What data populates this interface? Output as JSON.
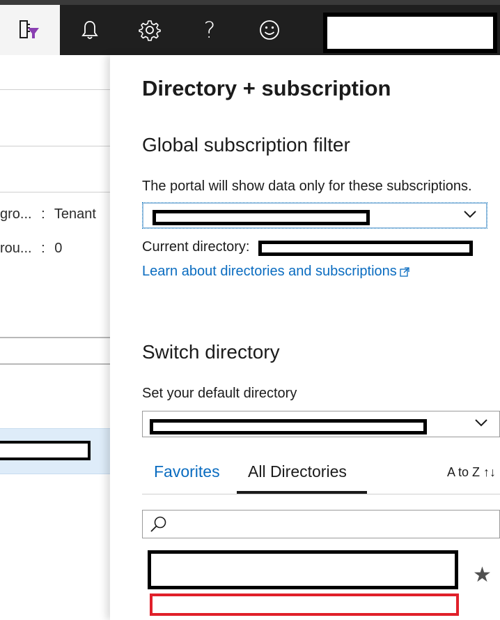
{
  "topbar": {
    "buttons": [
      {
        "name": "directory-filter-icon",
        "active": true
      },
      {
        "name": "bell-icon"
      },
      {
        "name": "gear-icon"
      },
      {
        "name": "help-icon",
        "glyph": "?"
      },
      {
        "name": "smiley-icon"
      }
    ],
    "account_redacted": true
  },
  "left_pane": {
    "rows": [
      {
        "label": "gro...",
        "separator": ":",
        "value": "Tenant"
      },
      {
        "label": "rou...",
        "separator": ":",
        "value": "0"
      }
    ],
    "selected_row_redacted": true
  },
  "panel": {
    "title": "Directory + subscription",
    "global_filter": {
      "heading": "Global subscription filter",
      "description": "The portal will show data only for these subscriptions.",
      "selected_value_redacted": true,
      "current_directory_label": "Current directory:",
      "learn_link": "Learn about directories and subscriptions"
    },
    "switch_directory": {
      "heading": "Switch directory",
      "default_label": "Set your default directory",
      "selected_value_redacted": true,
      "tabs": [
        {
          "label": "Favorites",
          "active": false
        },
        {
          "label": "All Directories",
          "active": true
        }
      ],
      "sort_label": "A to Z ↑↓",
      "search_placeholder": "",
      "directory_items": [
        {
          "name_redacted": true,
          "domain_redacted": true,
          "favorite_icon": "star-icon"
        }
      ]
    }
  },
  "colors": {
    "topbar_bg": "#1f1f1f",
    "active_button_bg": "#f4f4f4",
    "link": "#0a6cc0",
    "selected_row_bg": "#deecf9",
    "highlight_red": "#e0202a"
  }
}
